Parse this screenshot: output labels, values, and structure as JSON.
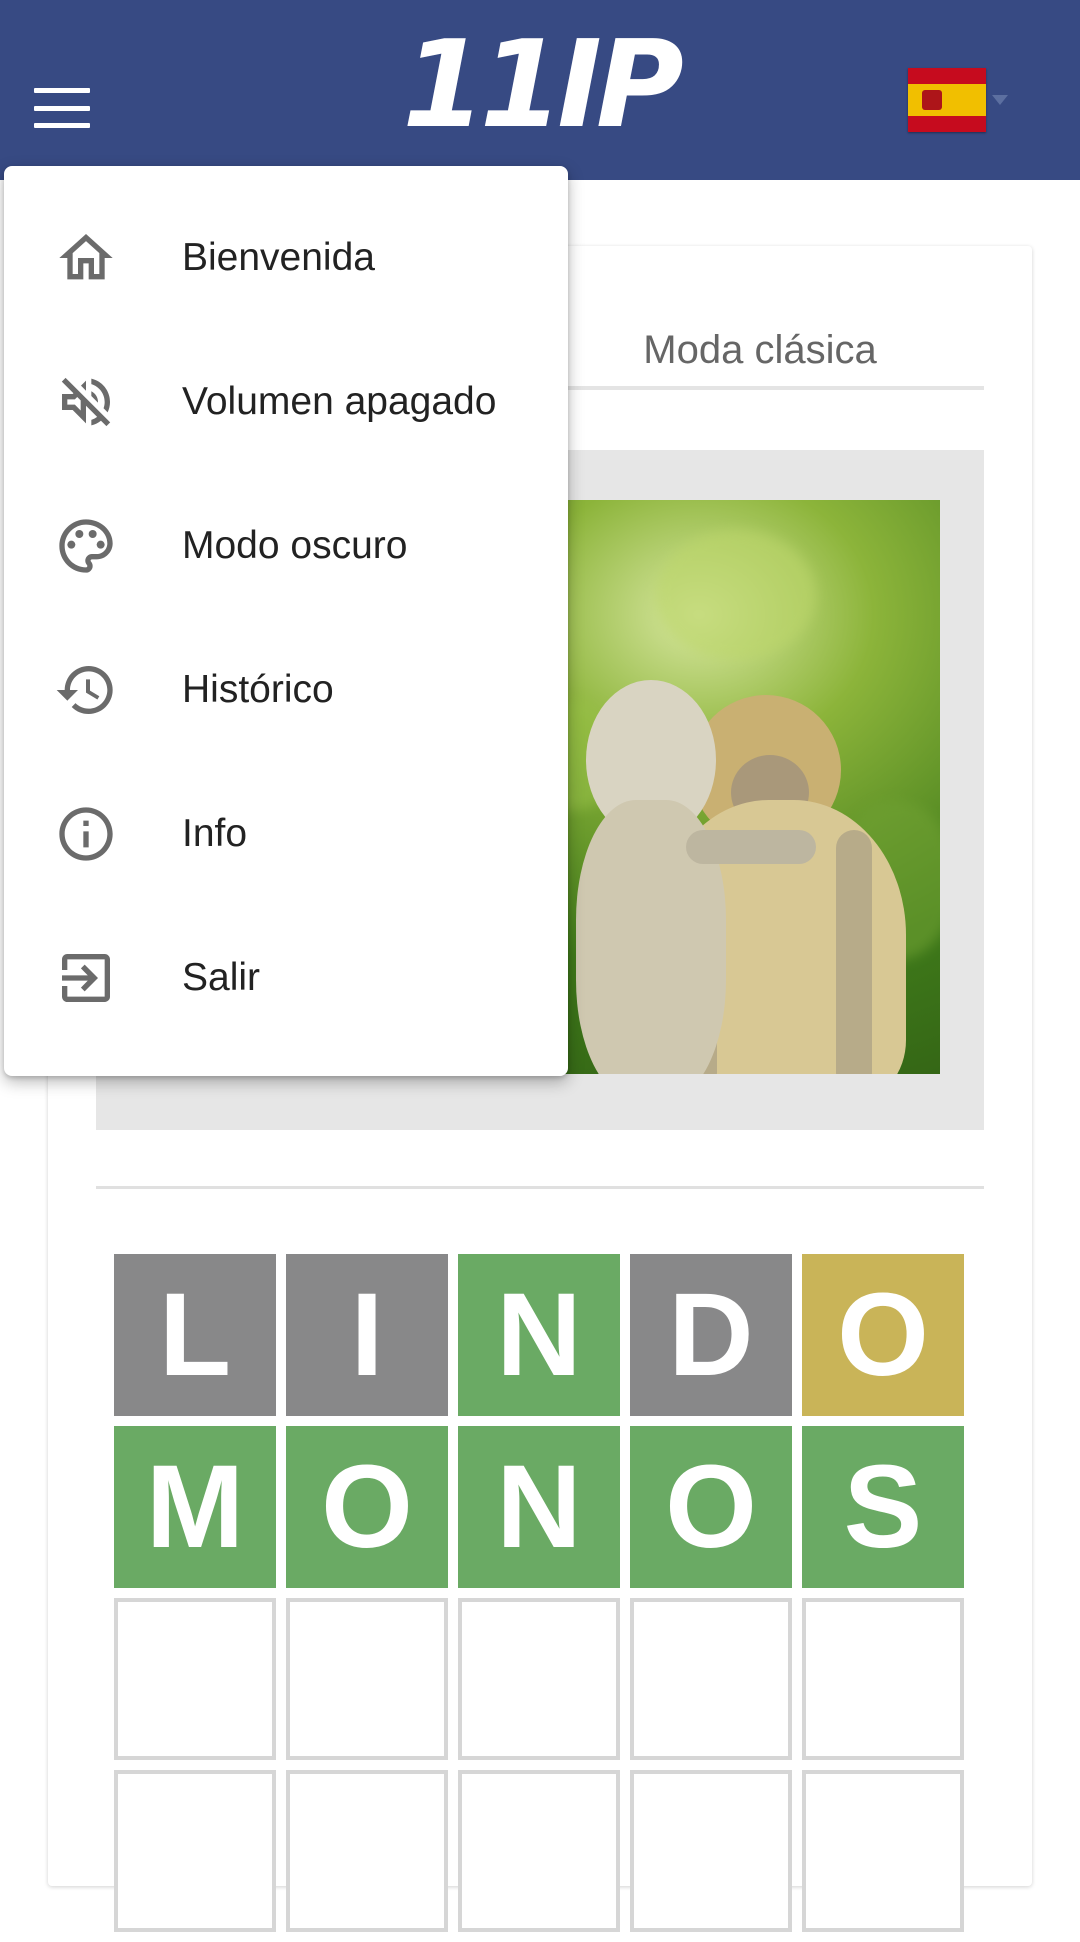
{
  "header": {
    "logo_text": "11IP",
    "language_flag": "Spain",
    "background_color": "#374a83"
  },
  "tabs": {
    "classic_label": "Moda clásica"
  },
  "menu": {
    "items": [
      {
        "icon": "home-icon",
        "label": "Bienvenida"
      },
      {
        "icon": "volume-off-icon",
        "label": "Volumen apagado"
      },
      {
        "icon": "palette-icon",
        "label": "Modo oscuro"
      },
      {
        "icon": "history-icon",
        "label": "Histórico"
      },
      {
        "icon": "info-icon",
        "label": "Info"
      },
      {
        "icon": "exit-icon",
        "label": "Salir"
      }
    ]
  },
  "game": {
    "image_subject": "two monkeys",
    "colors": {
      "absent": "#888889",
      "correct": "#6aaa64",
      "present": "#c9b458"
    },
    "rows": [
      [
        {
          "letter": "L",
          "state": "absent"
        },
        {
          "letter": "I",
          "state": "absent"
        },
        {
          "letter": "N",
          "state": "correct"
        },
        {
          "letter": "D",
          "state": "absent"
        },
        {
          "letter": "O",
          "state": "present"
        }
      ],
      [
        {
          "letter": "M",
          "state": "correct"
        },
        {
          "letter": "O",
          "state": "correct"
        },
        {
          "letter": "N",
          "state": "correct"
        },
        {
          "letter": "O",
          "state": "correct"
        },
        {
          "letter": "S",
          "state": "correct"
        }
      ],
      [
        {
          "letter": "",
          "state": "empty"
        },
        {
          "letter": "",
          "state": "empty"
        },
        {
          "letter": "",
          "state": "empty"
        },
        {
          "letter": "",
          "state": "empty"
        },
        {
          "letter": "",
          "state": "empty"
        }
      ],
      [
        {
          "letter": "",
          "state": "empty"
        },
        {
          "letter": "",
          "state": "empty"
        },
        {
          "letter": "",
          "state": "empty"
        },
        {
          "letter": "",
          "state": "empty"
        },
        {
          "letter": "",
          "state": "empty"
        }
      ]
    ]
  }
}
